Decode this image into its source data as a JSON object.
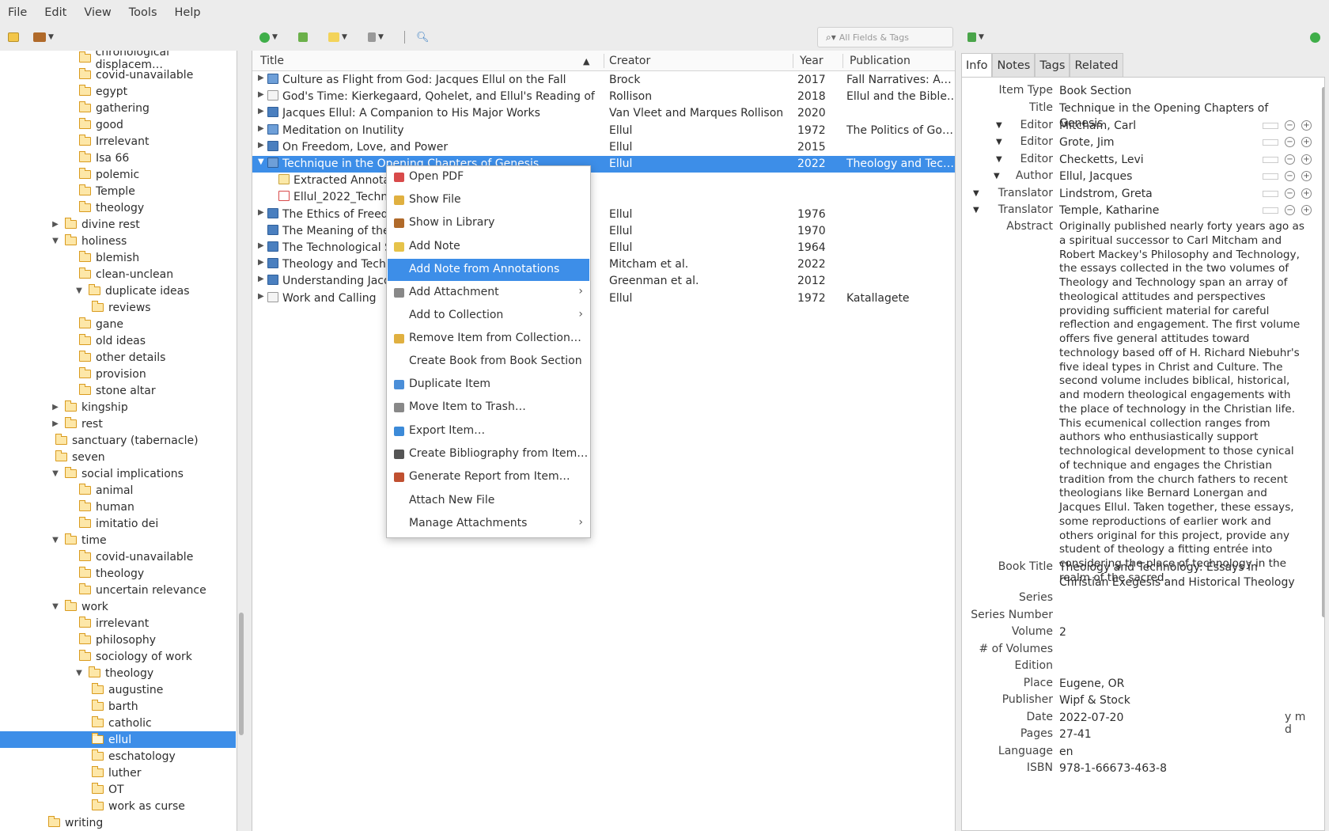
{
  "menubar": [
    "File",
    "Edit",
    "View",
    "Tools",
    "Help"
  ],
  "search": {
    "placeholder": "All Fields & Tags"
  },
  "collections": [
    {
      "label": "chronological displacem…",
      "indent": 2,
      "twisty": ""
    },
    {
      "label": "covid-unavailable",
      "indent": 2,
      "twisty": ""
    },
    {
      "label": "egypt",
      "indent": 2,
      "twisty": ""
    },
    {
      "label": "gathering",
      "indent": 2,
      "twisty": ""
    },
    {
      "label": "good",
      "indent": 2,
      "twisty": ""
    },
    {
      "label": "Irrelevant",
      "indent": 2,
      "twisty": ""
    },
    {
      "label": "Isa 66",
      "indent": 2,
      "twisty": ""
    },
    {
      "label": "polemic",
      "indent": 2,
      "twisty": ""
    },
    {
      "label": "Temple",
      "indent": 2,
      "twisty": ""
    },
    {
      "label": "theology",
      "indent": 2,
      "twisty": ""
    },
    {
      "label": "divine rest",
      "indent": 1,
      "twisty": "▶"
    },
    {
      "label": "holiness",
      "indent": 1,
      "twisty": "▼"
    },
    {
      "label": "blemish",
      "indent": 2,
      "twisty": ""
    },
    {
      "label": "clean-unclean",
      "indent": 2,
      "twisty": ""
    },
    {
      "label": "duplicate ideas",
      "indent": 2,
      "twisty": "▼"
    },
    {
      "label": "reviews",
      "indent": 3,
      "twisty": ""
    },
    {
      "label": "gane",
      "indent": 2,
      "twisty": ""
    },
    {
      "label": "old ideas",
      "indent": 2,
      "twisty": ""
    },
    {
      "label": "other details",
      "indent": 2,
      "twisty": ""
    },
    {
      "label": "provision",
      "indent": 2,
      "twisty": ""
    },
    {
      "label": "stone altar",
      "indent": 2,
      "twisty": ""
    },
    {
      "label": "kingship",
      "indent": 1,
      "twisty": "▶"
    },
    {
      "label": "rest",
      "indent": 1,
      "twisty": "▶"
    },
    {
      "label": "sanctuary (tabernacle)",
      "indent": 1,
      "twisty": ""
    },
    {
      "label": "seven",
      "indent": 1,
      "twisty": ""
    },
    {
      "label": "social implications",
      "indent": 1,
      "twisty": "▼"
    },
    {
      "label": "animal",
      "indent": 2,
      "twisty": ""
    },
    {
      "label": "human",
      "indent": 2,
      "twisty": ""
    },
    {
      "label": "imitatio dei",
      "indent": 2,
      "twisty": ""
    },
    {
      "label": "time",
      "indent": 1,
      "twisty": "▼"
    },
    {
      "label": "covid-unavailable",
      "indent": 2,
      "twisty": ""
    },
    {
      "label": "theology",
      "indent": 2,
      "twisty": ""
    },
    {
      "label": "uncertain relevance",
      "indent": 2,
      "twisty": ""
    },
    {
      "label": "work",
      "indent": 1,
      "twisty": "▼"
    },
    {
      "label": "irrelevant",
      "indent": 2,
      "twisty": ""
    },
    {
      "label": "philosophy",
      "indent": 2,
      "twisty": ""
    },
    {
      "label": "sociology of work",
      "indent": 2,
      "twisty": ""
    },
    {
      "label": "theology",
      "indent": 2,
      "twisty": "▼"
    },
    {
      "label": "augustine",
      "indent": 3,
      "twisty": ""
    },
    {
      "label": "barth",
      "indent": 3,
      "twisty": ""
    },
    {
      "label": "catholic",
      "indent": 3,
      "twisty": ""
    },
    {
      "label": "ellul",
      "indent": 3,
      "twisty": "",
      "selected": true
    },
    {
      "label": "eschatology",
      "indent": 3,
      "twisty": ""
    },
    {
      "label": "luther",
      "indent": 3,
      "twisty": ""
    },
    {
      "label": "OT",
      "indent": 3,
      "twisty": ""
    },
    {
      "label": "work as curse",
      "indent": 3,
      "twisty": ""
    },
    {
      "label": "writing",
      "indent": 0,
      "twisty": ""
    }
  ],
  "columns": {
    "title": "Title",
    "creator": "Creator",
    "year": "Year",
    "publication": "Publication"
  },
  "items": [
    {
      "title": "Culture as Flight from God: Jacques Ellul on the Fall",
      "creator": "Brock",
      "year": "2017",
      "publication": "Fall Narratives: A…",
      "icon": "sec",
      "twisty": "▶",
      "level": 0
    },
    {
      "title": "God's Time: Kierkegaard, Qohelet, and Ellul's Reading of Ec…",
      "creator": "Rollison",
      "year": "2018",
      "publication": "Ellul and the Bible…",
      "icon": "doc",
      "twisty": "▶",
      "level": 0
    },
    {
      "title": "Jacques Ellul: A Companion to His Major Works",
      "creator": "Van Vleet and Marques Rollison",
      "year": "2020",
      "publication": "",
      "icon": "bk",
      "twisty": "▶",
      "level": 0
    },
    {
      "title": "Meditation on Inutility",
      "creator": "Ellul",
      "year": "1972",
      "publication": "The Politics of Go…",
      "icon": "sec",
      "twisty": "▶",
      "level": 0
    },
    {
      "title": "On Freedom, Love, and Power",
      "creator": "Ellul",
      "year": "2015",
      "publication": "",
      "icon": "bk",
      "twisty": "▶",
      "level": 0
    },
    {
      "title": "Technique in the Opening Chapters of Genesis",
      "creator": "Ellul",
      "year": "2022",
      "publication": "Theology and Tec…",
      "icon": "sec",
      "twisty": "▼",
      "level": 0,
      "selected": true
    },
    {
      "title": "Extracted Annotat",
      "creator": "",
      "year": "",
      "publication": "",
      "icon": "note",
      "twisty": "",
      "level": 1
    },
    {
      "title": "Ellul_2022_Techni",
      "creator": "",
      "year": "",
      "publication": "",
      "icon": "pdf",
      "twisty": "",
      "level": 1
    },
    {
      "title": "The Ethics of Freedo",
      "creator": "Ellul",
      "year": "1976",
      "publication": "",
      "icon": "bk",
      "twisty": "▶",
      "level": 0
    },
    {
      "title": "The Meaning of the C",
      "creator": "Ellul",
      "year": "1970",
      "publication": "",
      "icon": "bk",
      "twisty": "",
      "level": 0
    },
    {
      "title": "The Technological S",
      "creator": "Ellul",
      "year": "1964",
      "publication": "",
      "icon": "bk",
      "twisty": "▶",
      "level": 0
    },
    {
      "title": "Theology and Techn",
      "creator": "Mitcham et al.",
      "year": "2022",
      "publication": "",
      "icon": "bk",
      "twisty": "▶",
      "level": 0
    },
    {
      "title": "Understanding Jacqu",
      "creator": "Greenman et al.",
      "year": "2012",
      "publication": "",
      "icon": "bk",
      "twisty": "▶",
      "level": 0
    },
    {
      "title": "Work and Calling",
      "creator": "Ellul",
      "year": "1972",
      "publication": "Katallagete",
      "icon": "doc",
      "twisty": "▶",
      "level": 0
    }
  ],
  "context_menu": [
    {
      "label": "Open PDF",
      "icon": "pdf-icon",
      "color": "#d84a4a",
      "sub": false
    },
    {
      "label": "Show File",
      "icon": "folder-icon",
      "color": "#e0b040",
      "sub": false
    },
    {
      "label": "Show in Library",
      "icon": "library-icon",
      "color": "#b06a2a",
      "sub": false
    },
    {
      "label": "Add Note",
      "icon": "note-add-icon",
      "color": "#e6c34a",
      "sub": false
    },
    {
      "label": "Add Note from Annotations",
      "icon": "",
      "color": "",
      "sub": false,
      "highlight": true
    },
    {
      "label": "Add Attachment",
      "icon": "paperclip-icon",
      "color": "#888888",
      "sub": true
    },
    {
      "label": "Add to Collection",
      "icon": "",
      "color": "",
      "sub": true
    },
    {
      "label": "Remove Item from Collection…",
      "icon": "folder-remove-icon",
      "color": "#e0b040",
      "sub": false
    },
    {
      "label": "Create Book from Book Section",
      "icon": "",
      "color": "",
      "sub": false
    },
    {
      "label": "Duplicate Item",
      "icon": "duplicate-icon",
      "color": "#4a8ed8",
      "sub": false
    },
    {
      "label": "Move Item to Trash…",
      "icon": "trash-icon",
      "color": "#888888",
      "sub": false
    },
    {
      "label": "Export Item…",
      "icon": "export-icon",
      "color": "#3c8ad8",
      "sub": false
    },
    {
      "label": "Create Bibliography from Item…",
      "icon": "bibliography-icon",
      "color": "#555555",
      "sub": false
    },
    {
      "label": "Generate Report from Item…",
      "icon": "report-icon",
      "color": "#c05030",
      "sub": false
    },
    {
      "label": "Attach New File",
      "icon": "",
      "color": "",
      "sub": false
    },
    {
      "label": "Manage Attachments",
      "icon": "",
      "color": "",
      "sub": true
    }
  ],
  "tabs": [
    "Info",
    "Notes",
    "Tags",
    "Related"
  ],
  "info": {
    "item_type_label": "Item Type",
    "item_type": "Book Section",
    "title_label": "Title",
    "title": "Technique in the Opening Chapters of Genesis",
    "creators": [
      {
        "role": "Editor",
        "name": "Mitcham, Carl"
      },
      {
        "role": "Editor",
        "name": "Grote, Jim"
      },
      {
        "role": "Editor",
        "name": "Checketts, Levi"
      },
      {
        "role": "Author",
        "name": "Ellul, Jacques"
      },
      {
        "role": "Translator",
        "name": "Lindstrom, Greta"
      },
      {
        "role": "Translator",
        "name": "Temple, Katharine"
      }
    ],
    "abstract_label": "Abstract",
    "abstract": "Originally published nearly forty years ago as a spiritual successor to Carl Mitcham and Robert Mackey's Philosophy and Technology, the essays collected in the two volumes of Theology and Technology span an array of theological attitudes and perspectives providing sufficient material for careful reflection and engagement. The first volume offers five general attitudes toward technology based off of H. Richard Niebuhr's five ideal types in Christ and Culture. The second volume includes biblical, historical, and modern theological engagements with the place of technology in the Christian life. This ecumenical collection ranges from authors who enthusiastically support technological development to those cynical of technique and engages the Christian tradition from the church fathers to recent theologians like Bernard Lonergan and Jacques Ellul. Taken together, these essays, some reproductions of earlier work and others original for this project, provide any student of theology a fitting entrée into considering the place of technology in the realm of the sacred.",
    "book_title_label": "Book Title",
    "book_title": "Theology and Technology: Essays in Christian Exegesis and Historical Theology",
    "series_label": "Series",
    "series": "",
    "series_number_label": "Series Number",
    "series_number": "",
    "volume_label": "Volume",
    "volume": "2",
    "num_volumes_label": "# of Volumes",
    "num_volumes": "",
    "edition_label": "Edition",
    "edition": "",
    "place_label": "Place",
    "place": "Eugene, OR",
    "publisher_label": "Publisher",
    "publisher": "Wipf & Stock",
    "date_label": "Date",
    "date": "2022-07-20",
    "date_format": "y m d",
    "pages_label": "Pages",
    "pages": "27-41",
    "language_label": "Language",
    "language": "en",
    "isbn_label": "ISBN",
    "isbn": "978-1-66673-463-8"
  },
  "colors": {
    "selection": "#3d8ee8",
    "folder": "#fde7a8"
  }
}
